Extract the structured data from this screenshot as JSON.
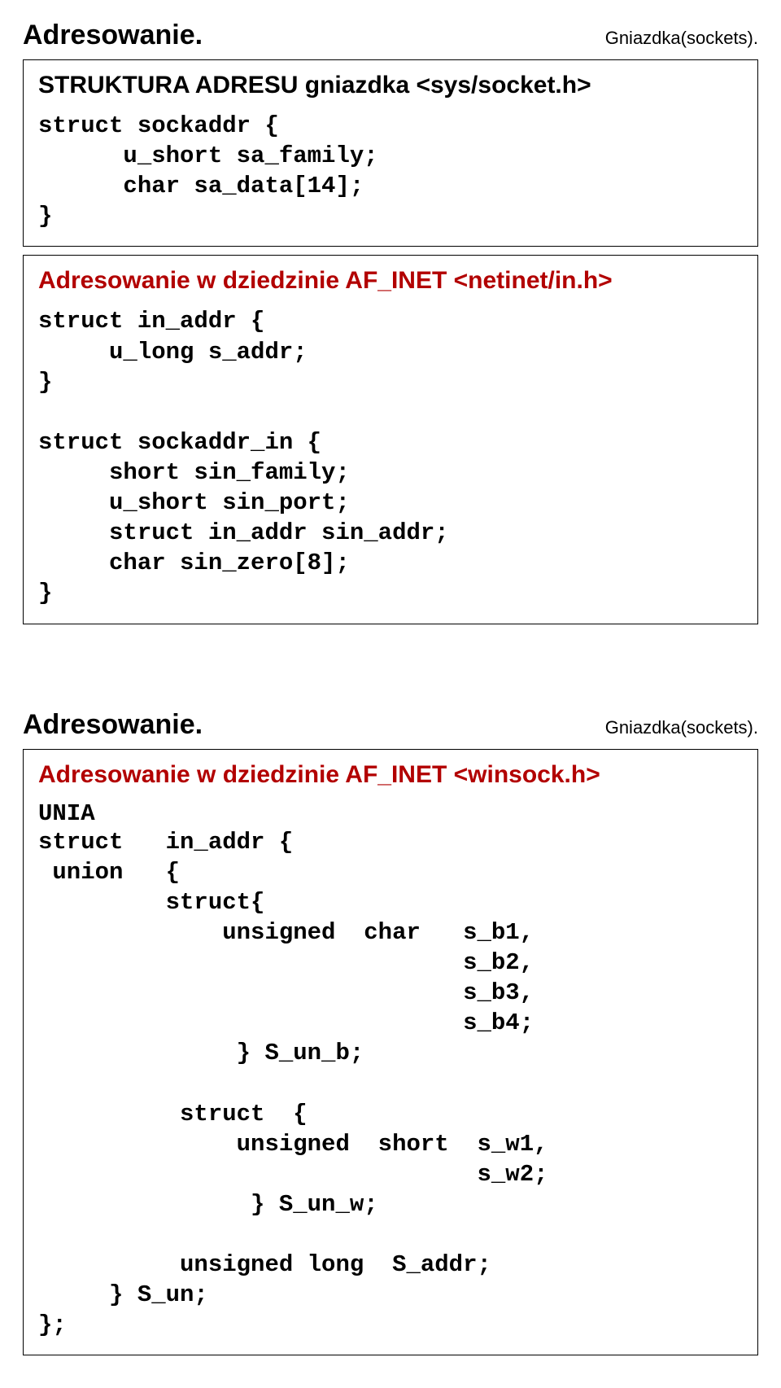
{
  "slide1": {
    "title": "Adresowanie.",
    "subtitle": "Gniazdka(sockets).",
    "box1": {
      "heading": "STRUKTURA ADRESU gniazdka <sys/socket.h>",
      "code": "struct sockaddr {\n      u_short sa_family;\n      char sa_data[14];\n}"
    },
    "box2": {
      "heading": "Adresowanie w dziedzinie AF_INET <netinet/in.h>",
      "code": "struct in_addr {\n     u_long s_addr;\n}\n\nstruct sockaddr_in {\n     short sin_family;\n     u_short sin_port;\n     struct in_addr sin_addr;\n     char sin_zero[8];\n}"
    }
  },
  "slide2": {
    "title": "Adresowanie.",
    "subtitle": "Gniazdka(sockets).",
    "box": {
      "heading": "Adresowanie w dziedzinie AF_INET <winsock.h>",
      "unia": "UNIA",
      "code": "struct   in_addr {\n union   {\n         struct{\n             unsigned  char   s_b1,\n                              s_b2,\n                              s_b3,\n                              s_b4;\n              } S_un_b;\n\n          struct  {\n              unsigned  short  s_w1,\n                               s_w2;\n               } S_un_w;\n\n          unsigned long  S_addr;\n     } S_un;\n};"
    }
  }
}
